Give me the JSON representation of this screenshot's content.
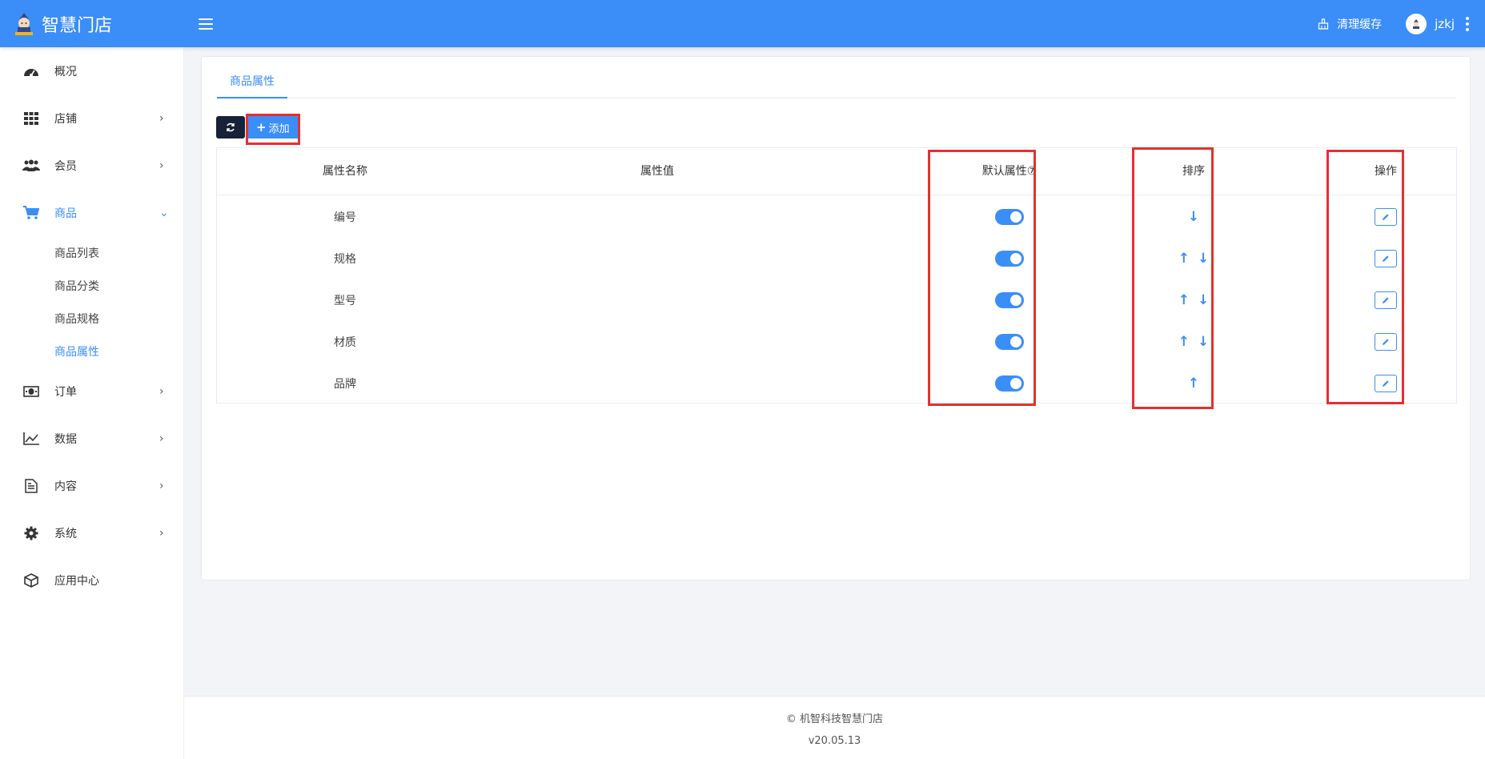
{
  "header": {
    "brand": "智慧门店",
    "clear_cache": "清理缓存",
    "username": "jzkj"
  },
  "sidebar": {
    "items": [
      {
        "label": "概况"
      },
      {
        "label": "店铺"
      },
      {
        "label": "会员"
      },
      {
        "label": "商品"
      },
      {
        "label": "订单"
      },
      {
        "label": "数据"
      },
      {
        "label": "内容"
      },
      {
        "label": "系统"
      },
      {
        "label": "应用中心"
      }
    ],
    "sub_items": [
      {
        "label": "商品列表"
      },
      {
        "label": "商品分类"
      },
      {
        "label": "商品规格"
      },
      {
        "label": "商品属性"
      }
    ]
  },
  "main": {
    "tab": "商品属性",
    "add_label": "添加",
    "columns": [
      "属性名称",
      "属性值",
      "默认属性⑦",
      "排序",
      "操作"
    ],
    "rows": [
      {
        "name": "编号",
        "value": "",
        "default_on": true,
        "sort": [
          "down"
        ]
      },
      {
        "name": "规格",
        "value": "",
        "default_on": true,
        "sort": [
          "up",
          "down"
        ]
      },
      {
        "name": "型号",
        "value": "",
        "default_on": true,
        "sort": [
          "up",
          "down"
        ]
      },
      {
        "name": "材质",
        "value": "",
        "default_on": true,
        "sort": [
          "up",
          "down"
        ]
      },
      {
        "name": "品牌",
        "value": "",
        "default_on": true,
        "sort": [
          "up"
        ]
      }
    ],
    "arrows": {
      "up": "↑",
      "down": "↓"
    }
  },
  "footer": {
    "copyright": "© 机智科技智慧门店",
    "version": "v20.05.13"
  },
  "colors": {
    "primary": "#3b8ef7",
    "dark_button": "#182236",
    "highlight": "#e53030"
  }
}
